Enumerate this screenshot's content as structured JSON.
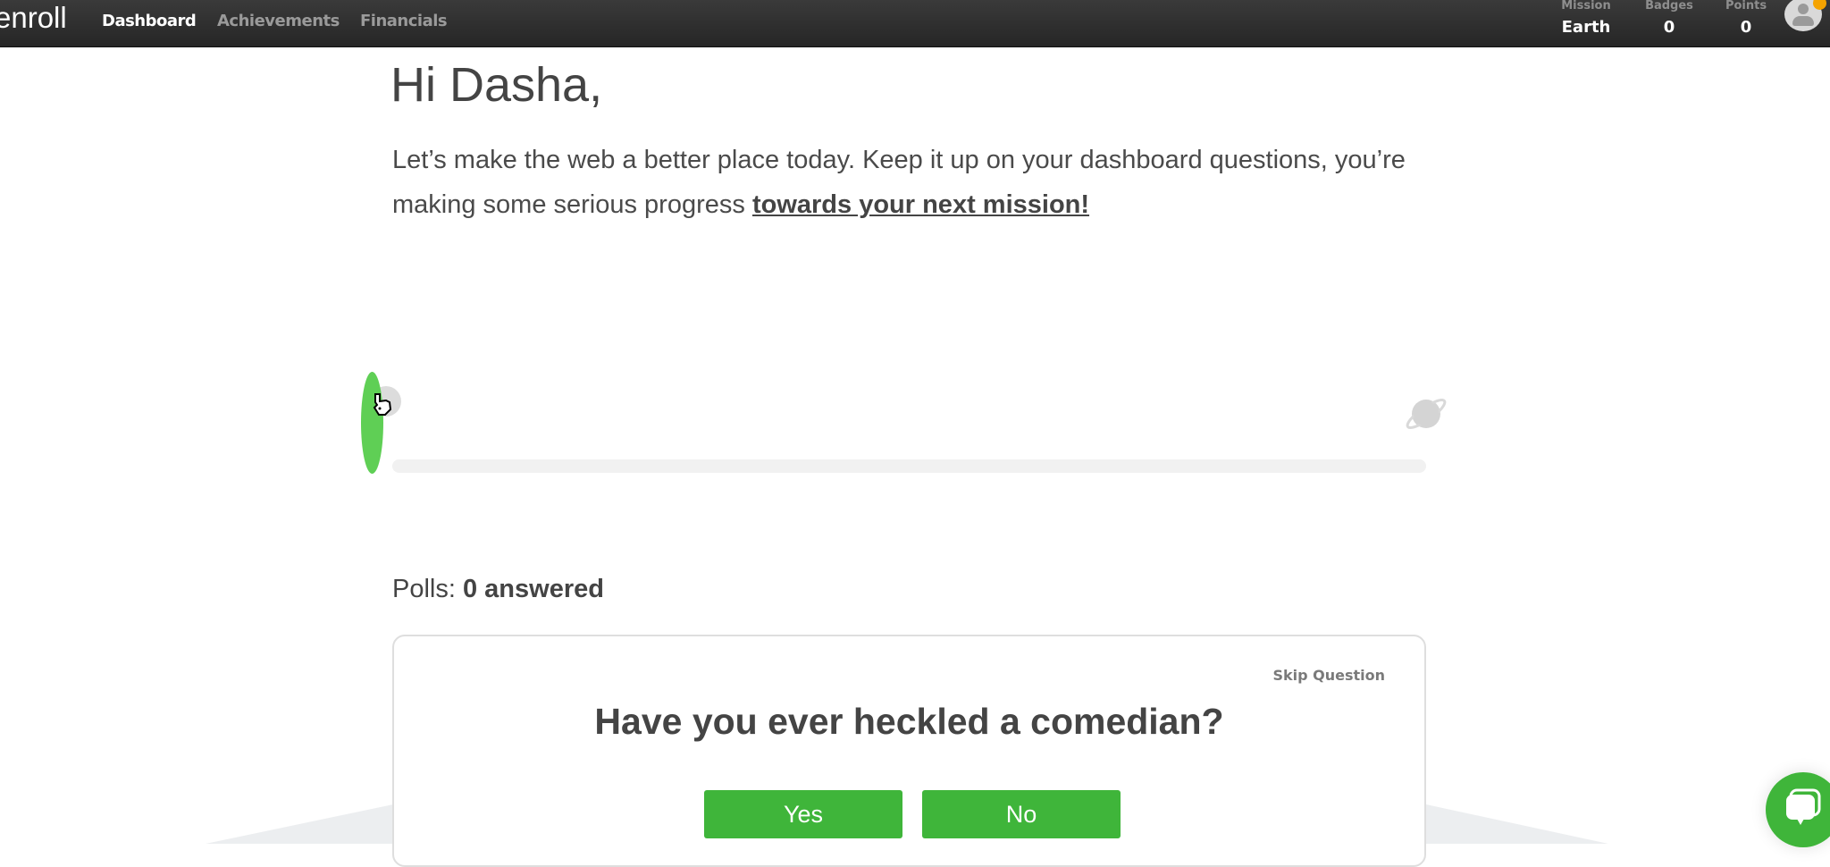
{
  "nav": {
    "logo": "enroll",
    "items": [
      {
        "label": "Dashboard",
        "active": true
      },
      {
        "label": "Achievements",
        "active": false
      },
      {
        "label": "Financials",
        "active": false
      }
    ],
    "stats": [
      {
        "label": "Mission",
        "value": "Earth"
      },
      {
        "label": "Badges",
        "value": "0"
      },
      {
        "label": "Points",
        "value": "0"
      }
    ],
    "avatar_icon": "user-avatar-icon",
    "notification_color": "#f5a300"
  },
  "main": {
    "greeting": "Hi Dasha,",
    "intro_text": "Let’s make the web a better place today. Keep it up on your dashboard questions, you’re making some serious progress ",
    "intro_link": "towards your next mission!",
    "progress": {
      "value_percent": 0,
      "start_icon": "start-marker-icon",
      "end_icon": "planet-icon",
      "fill_color": "#43b93a"
    },
    "polls": {
      "label": "Polls:",
      "count_text": "0 answered"
    },
    "poll_card": {
      "skip_label": "Skip Question",
      "question": "Have you ever heckled a comedian?",
      "options": [
        "Yes",
        "No"
      ],
      "button_color": "#3fb53a"
    }
  },
  "chat": {
    "icon": "chat-bubble-icon"
  }
}
